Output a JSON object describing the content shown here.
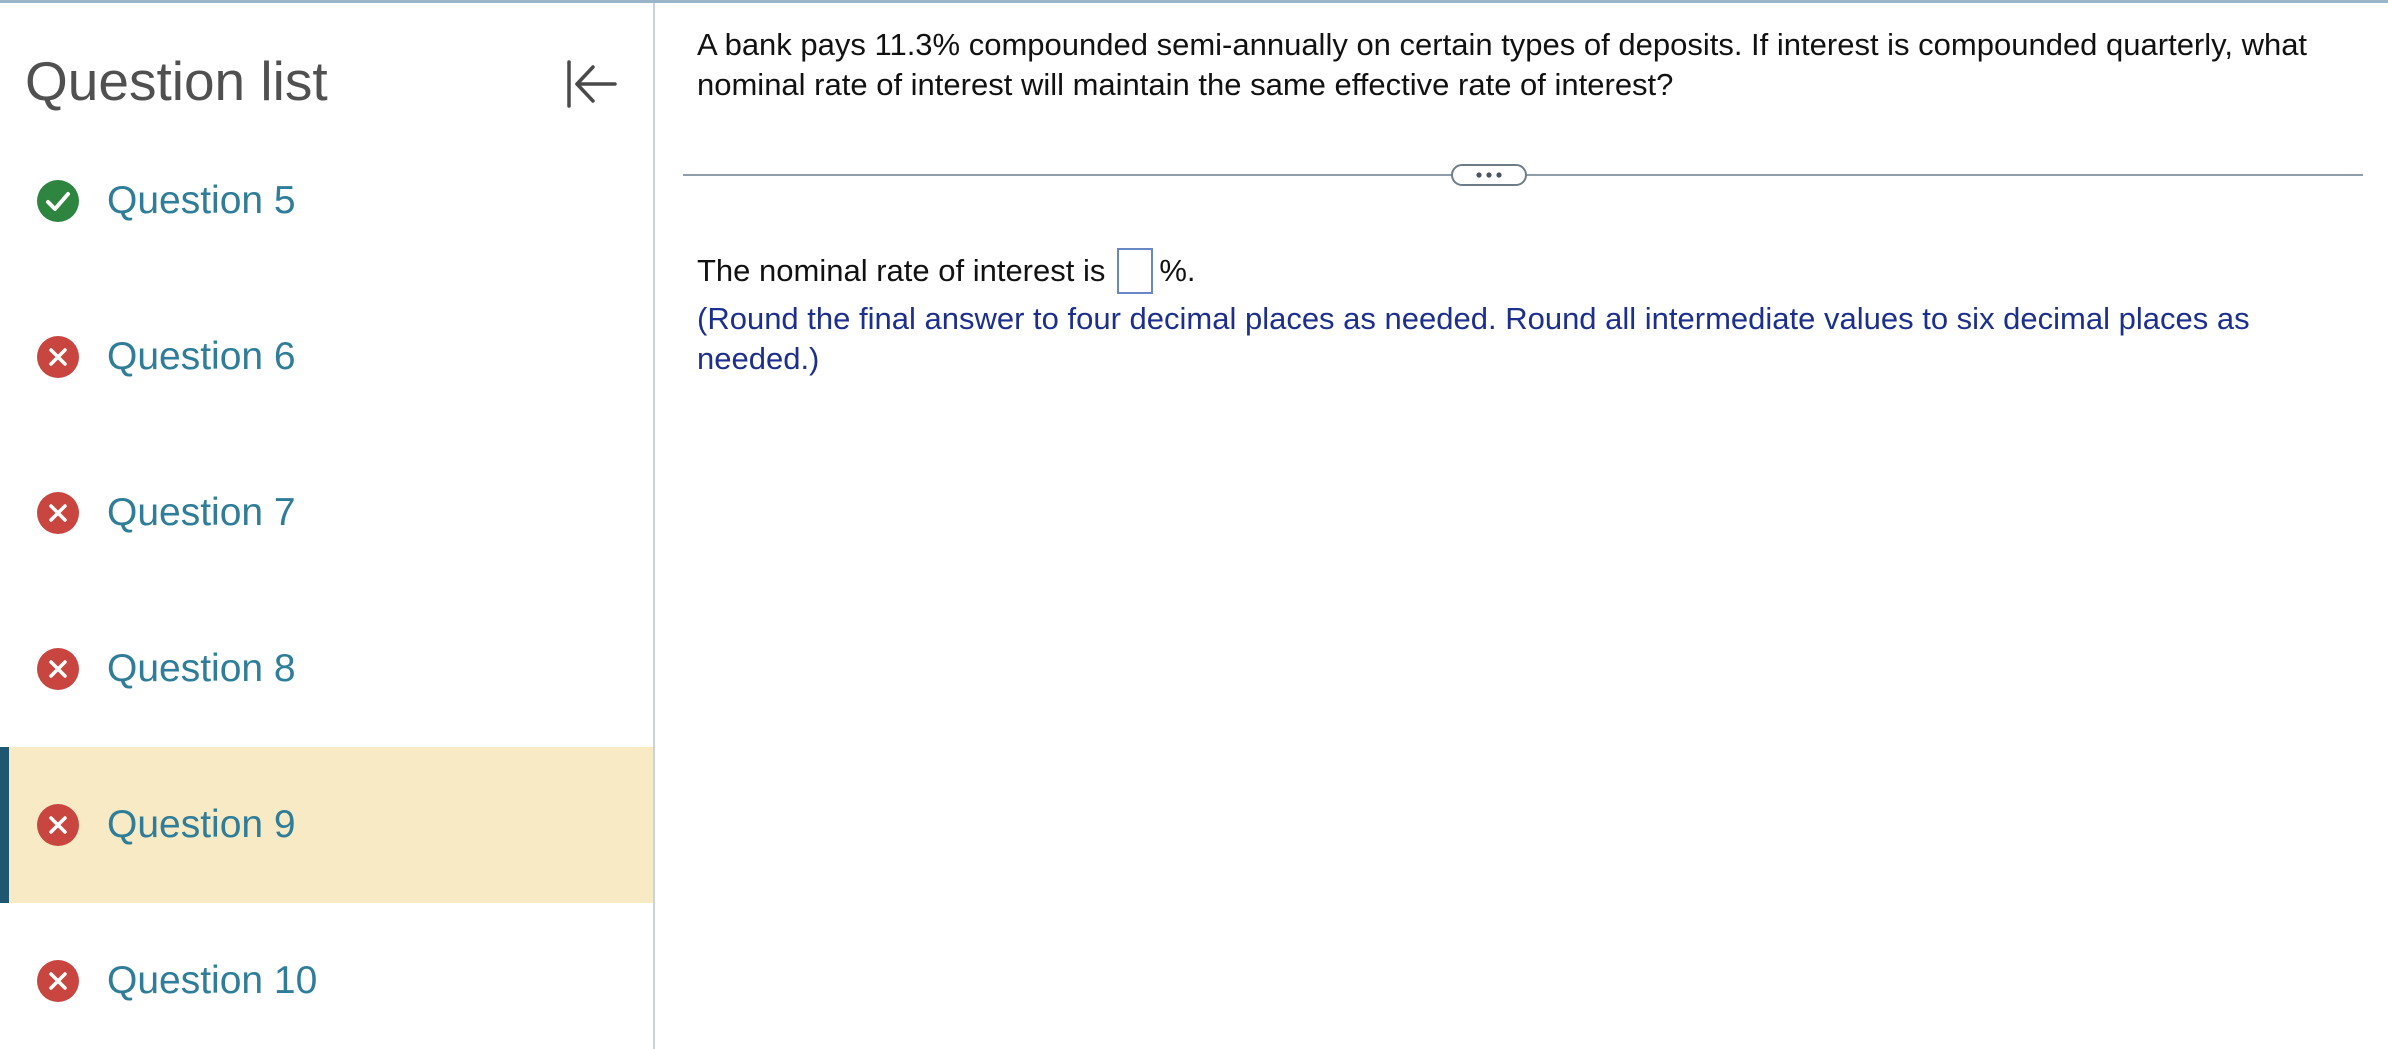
{
  "sidebar": {
    "title": "Question list",
    "collapse_icon": "collapse-left-icon",
    "items": [
      {
        "label": "Question 5",
        "status": "correct",
        "icon": "check-circle-icon"
      },
      {
        "label": "Question 6",
        "status": "incorrect",
        "icon": "x-circle-icon"
      },
      {
        "label": "Question 7",
        "status": "incorrect",
        "icon": "x-circle-icon"
      },
      {
        "label": "Question 8",
        "status": "incorrect",
        "icon": "x-circle-icon"
      },
      {
        "label": "Question 9",
        "status": "incorrect",
        "icon": "x-circle-icon",
        "active": true
      },
      {
        "label": "Question 10",
        "status": "incorrect",
        "icon": "x-circle-icon"
      }
    ]
  },
  "question": {
    "prompt": "A bank pays 11.3% compounded semi-annually on certain types of deposits. If interest is compounded quarterly, what nominal rate of interest will maintain the same effective rate of interest?",
    "expand_icon": "more-horizontal-icon",
    "answer_prefix": "The nominal rate of interest is",
    "answer_value": "",
    "answer_suffix": "%.",
    "instructions": "(Round the final answer to four decimal places as needed. Round all intermediate values to six decimal places as needed.)"
  },
  "colors": {
    "correct": "#2e8540",
    "incorrect": "#c8463f",
    "link": "#2f7d99",
    "active_bg": "#f7eac4",
    "active_accent": "#1f5770",
    "instruction_text": "#1c2f8c"
  }
}
